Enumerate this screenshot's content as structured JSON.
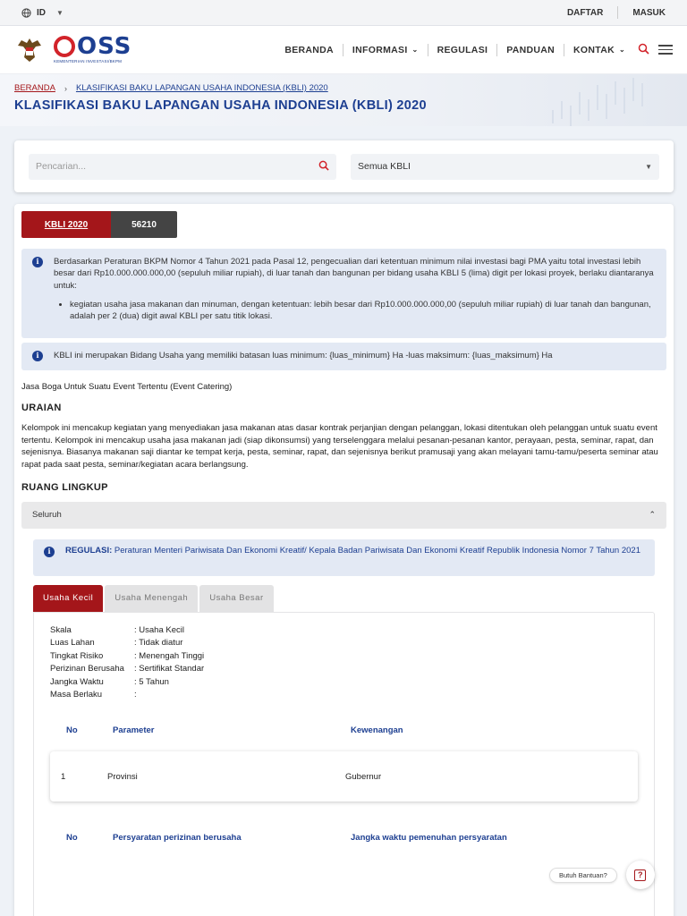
{
  "topbar": {
    "lang": "ID",
    "daftar": "DAFTAR",
    "masuk": "MASUK"
  },
  "header": {
    "logo_text": "OSS",
    "logo_sub": "KEMENTERIAN INVESTASI/BKPM",
    "nav": [
      "BERANDA",
      "INFORMASI",
      "REGULASI",
      "PANDUAN",
      "KONTAK"
    ]
  },
  "breadcrumb": {
    "home": "BERANDA",
    "current": "KLASIFIKASI BAKU LAPANGAN USAHA INDONESIA (KBLI) 2020"
  },
  "page_title": "KLASIFIKASI BAKU LAPANGAN USAHA INDONESIA (KBLI) 2020",
  "search": {
    "placeholder": "Pencarian...",
    "select_value": "Semua KBLI"
  },
  "tabs": {
    "kbli": "KBLI 2020",
    "code": "56210"
  },
  "alert1": {
    "text": "Berdasarkan Peraturan BKPM Nomor 4 Tahun 2021 pada Pasal 12, pengecualian dari ketentuan minimum nilai investasi bagi PMA yaitu total investasi lebih besar dari Rp10.000.000.000,00 (sepuluh miliar rupiah), di luar tanah dan bangunan per bidang usaha KBLI 5 (lima) digit per lokasi proyek, berlaku diantaranya untuk:",
    "bullet": "kegiatan usaha jasa makanan dan minuman, dengan ketentuan: lebih besar dari Rp10.000.000.000,00 (sepuluh miliar rupiah) di luar tanah dan bangunan, adalah per 2 (dua) digit awal KBLI per satu titik lokasi."
  },
  "alert2": {
    "text": "KBLI ini merupakan Bidang Usaha yang memiliki batasan luas minimum: {luas_minimum} Ha -luas maksimum: {luas_maksimum} Ha"
  },
  "kbli_name": "Jasa Boga Untuk Suatu Event Tertentu (Event Catering)",
  "uraian": {
    "heading": "URAIAN",
    "text": "Kelompok ini mencakup kegiatan yang menyediakan jasa makanan atas dasar kontrak perjanjian dengan pelanggan, lokasi ditentukan oleh pelanggan untuk suatu event tertentu. Kelompok ini mencakup usaha jasa makanan jadi (siap dikonsumsi) yang terselenggara melalui pesanan-pesanan kantor, perayaan, pesta, seminar, rapat, dan sejenisnya. Biasanya makanan saji diantar ke tempat kerja, pesta, seminar, rapat, dan sejenisnya berikut pramusaji yang akan melayani tamu-tamu/peserta seminar atau rapat pada saat pesta, seminar/kegiatan acara berlangsung."
  },
  "ruang_lingkup": {
    "heading": "RUANG LINGKUP",
    "accordion_label": "Seluruh",
    "regulasi_label": "REGULASI:",
    "regulasi_text": "Peraturan Menteri Pariwisata Dan Ekonomi Kreatif/ Kepala Badan Pariwisata Dan Ekonomi Kreatif Republik Indonesia Nomor 7 Tahun 2021"
  },
  "scale_tabs": [
    "Usaha Kecil",
    "Usaha Menengah",
    "Usaha Besar"
  ],
  "details": [
    {
      "key": "Skala",
      "value": ": Usaha Kecil"
    },
    {
      "key": "Luas Lahan",
      "value": ": Tidak diatur"
    },
    {
      "key": "Tingkat Risiko",
      "value": ": Menengah Tinggi"
    },
    {
      "key": "Perizinan Berusaha",
      "value": ": Sertifikat Standar"
    },
    {
      "key": "Jangka Waktu",
      "value": ": 5 Tahun"
    },
    {
      "key": "Masa Berlaku",
      "value": ":"
    }
  ],
  "table1": {
    "headers": [
      "No",
      "Parameter",
      "Kewenangan"
    ],
    "rows": [
      [
        "1",
        "Provinsi",
        "Gubernur"
      ]
    ]
  },
  "table2": {
    "headers": [
      "No",
      "Persyaratan perizinan berusaha",
      "Jangka waktu pemenuhan persyaratan"
    ]
  },
  "help": {
    "label": "Butuh Bantuan?",
    "icon": "?"
  },
  "colors": {
    "brand_red": "#a4161a",
    "brand_blue": "#1d3f91"
  }
}
